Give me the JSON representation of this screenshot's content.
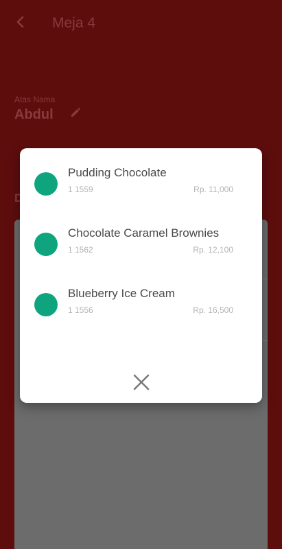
{
  "header": {
    "title": "Meja 4"
  },
  "owner": {
    "label": "Atas Nama",
    "name": "Abdul"
  },
  "section": {
    "letter": "D"
  },
  "dialog": {
    "items": [
      {
        "name": "Pudding Chocolate",
        "code": "1 1559",
        "price": "Rp. 11,000"
      },
      {
        "name": "Chocolate Caramel Brownies",
        "code": "1 1562",
        "price": "Rp. 12,100"
      },
      {
        "name": "Blueberry Ice Cream",
        "code": "1 1556",
        "price": "Rp. 16,500"
      }
    ]
  },
  "colors": {
    "background": "#5e0d0d",
    "accent_dot": "#0ea57e",
    "dialog_bg": "#ffffff",
    "panel": "#6c6c6c"
  },
  "icons": {
    "back": "chevron-left-icon",
    "edit": "pencil-icon",
    "close": "close-icon"
  }
}
